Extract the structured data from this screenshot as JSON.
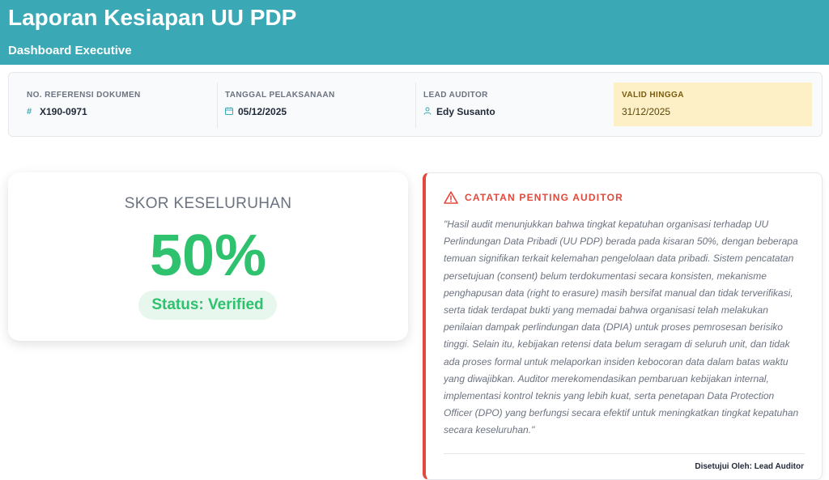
{
  "header": {
    "title": "Laporan Kesiapan UU PDP",
    "subtitle": "Dashboard Executive",
    "color": "#3aa9b5"
  },
  "meta": {
    "ref_label": "NO. REFERENSI DOKUMEN",
    "ref_icon": "hash-icon",
    "ref_value": "X190-0971",
    "date_label": "TANGGAL PELAKSANAAN",
    "date_icon": "calendar-icon",
    "date_value": "05/12/2025",
    "auditor_label": "LEAD AUDITOR",
    "auditor_icon": "user-icon",
    "auditor_value": "Edy Susanto",
    "valid_label": "VALID HINGGA",
    "valid_value": "31/12/2025"
  },
  "score": {
    "label": "SKOR KESELURUHAN",
    "value": "50%",
    "status": "Status: Verified",
    "color": "#2ec16e"
  },
  "note": {
    "icon": "warning-icon",
    "title": "CATATAN PENTING AUDITOR",
    "body": "\"Hasil audit menunjukkan bahwa tingkat kepatuhan organisasi terhadap UU Perlindungan Data Pribadi (UU PDP) berada pada kisaran 50%, dengan beberapa temuan signifikan terkait kelemahan pengelolaan data pribadi. Sistem pencatatan persetujuan (consent) belum terdokumentasi secara konsisten, mekanisme penghapusan data (right to erasure) masih bersifat manual dan tidak terverifikasi, serta tidak terdapat bukti yang memadai bahwa organisasi telah melakukan penilaian dampak perlindungan data (DPIA) untuk proses pemrosesan berisiko tinggi. Selain itu, kebijakan retensi data belum seragam di seluruh unit, dan tidak ada proses formal untuk melaporkan insiden kebocoran data dalam batas waktu yang diwajibkan. Auditor merekomendasikan pembaruan kebijakan internal, implementasi kontrol teknis yang lebih kuat, serta penetapan Data Protection Officer (DPO) yang berfungsi secara efektif untuk meningkatkan tingkat kepatuhan secara keseluruhan.\"",
    "signature": "Disetujui Oleh: Lead Auditor",
    "color": "#e3483b"
  }
}
